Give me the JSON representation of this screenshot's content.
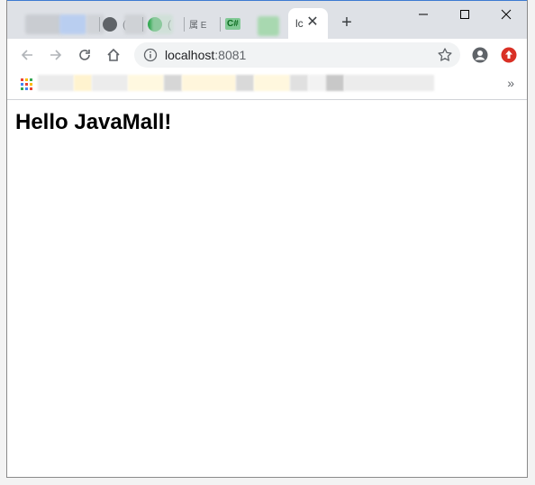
{
  "browser": {
    "active_tab": {
      "title": "lc",
      "close_glyph": "✕"
    },
    "new_tab_glyph": "+",
    "address": {
      "host": "localhost",
      "port": ":8081"
    },
    "bookmarks_overflow": "»",
    "background_tabs": [
      {
        "fragment": "",
        "favicon_color": "#9aa0a6"
      },
      {
        "fragment": "",
        "favicon_color": "#8ab4f8"
      },
      {
        "fragment": "(",
        "favicon_color": "#5f6368"
      },
      {
        "fragment": "(",
        "favicon_color": "#34a853"
      },
      {
        "fragment": "属 E",
        "favicon_color": "#dee1e6"
      },
      {
        "fragment": "C#",
        "favicon_color": "#81c995"
      }
    ],
    "colors": {
      "titlebar": "#dee1e6",
      "profile_icon": "#5f6368",
      "extension_icon": "#d93025"
    }
  },
  "page": {
    "heading": "Hello JavaMall!"
  }
}
